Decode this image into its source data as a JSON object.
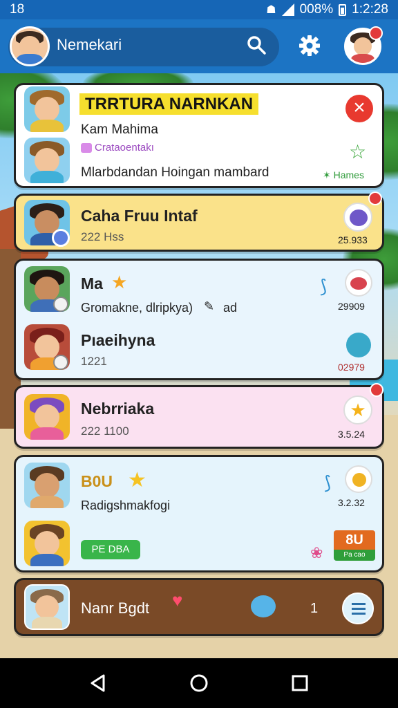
{
  "status": {
    "time": "18",
    "battery": "008%",
    "clock": "1:2:28"
  },
  "appbar": {
    "title": "Nemekari"
  },
  "cards": [
    {
      "name": "TRRTURA NARNKAN",
      "sub": "Kam Mahima",
      "tag": "Crataoentakı",
      "message": "Mlarbdandan Hoingan mambard",
      "footer": "Hames"
    },
    {
      "name": "Caha Fruu Intaf",
      "meta": "222 Hss",
      "time": "25.933"
    },
    {
      "name": "Ma",
      "message": "Gromakne, dlripkya)",
      "extra": "ad",
      "time": "29909"
    },
    {
      "name": "Pıaeihyna",
      "meta": "1221",
      "time": "02979"
    },
    {
      "name": "Nebrriaka",
      "meta": "222 1100",
      "time": "3.5.24"
    },
    {
      "name": "B0U",
      "message": "Radigshmakfogi",
      "time": "3.2.32",
      "button": "PE DBA",
      "score_top": "8U",
      "score_bottom": "Pa cao"
    },
    {
      "name": "Nanr Bgdt",
      "count": "1"
    }
  ],
  "colors": {
    "statusbar": "#1666b6",
    "appbar": "#1c74c4",
    "close": "#e8392f",
    "highlight": "#f6df2e",
    "green_button": "#39b54a"
  },
  "icons": [
    "search-icon",
    "gear-icon",
    "close-icon",
    "star-icon",
    "heart-icon",
    "bird-icon",
    "menu-icon",
    "back-icon",
    "home-icon",
    "recents-icon"
  ]
}
